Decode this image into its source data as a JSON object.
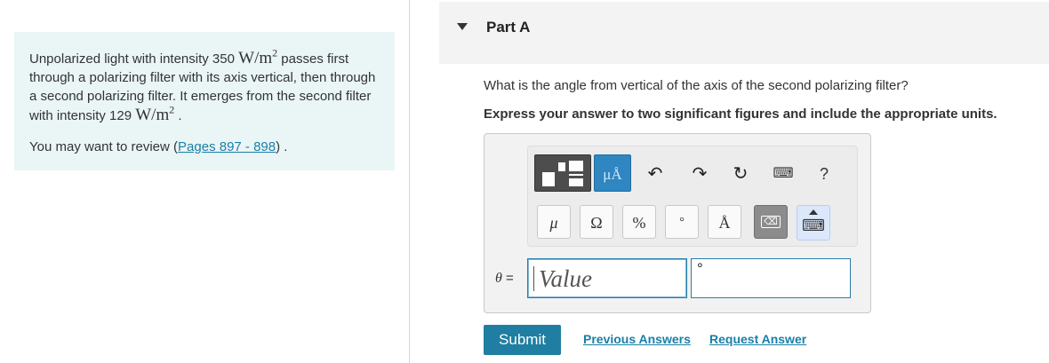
{
  "problem": {
    "text_part1": "Unpolarized light with intensity 350 ",
    "unit1_base": "W/m",
    "unit1_exp": "2",
    "text_part2": " passes first through a polarizing filter with its axis vertical, then through a second polarizing filter. It emerges from the second filter with intensity 129 ",
    "unit2_base": "W/m",
    "unit2_exp": "2",
    "text_part3": " .",
    "review_prefix": "You may want to review (",
    "review_link": "Pages 897 - 898",
    "review_suffix": ") ."
  },
  "part": {
    "title": "Part A",
    "question": "What is the angle from vertical of the axis of the second polarizing filter?",
    "instruction": "Express your answer to two significant figures and include the appropriate units."
  },
  "toolbar": {
    "units_button": "μÅ",
    "undo_glyph": "↶",
    "redo_glyph": "↷",
    "reset_glyph": "↻",
    "keyboard_glyph": "⌨",
    "help_glyph": "?",
    "symbols": [
      "μ",
      "Ω",
      "%",
      "°",
      "Å"
    ],
    "backspace_glyph": "⌫",
    "keyboard_toggle_glyph": "⌨",
    "icons": [
      "template-icon",
      "units-icon",
      "undo-icon",
      "redo-icon",
      "reset-icon",
      "keyboard-icon",
      "help-icon",
      "backspace-icon",
      "keyboard-toggle-icon"
    ]
  },
  "answer": {
    "variable": "θ",
    "equals": " =",
    "value_placeholder": "Value",
    "units_value": "°"
  },
  "actions": {
    "submit": "Submit",
    "previous_answers": "Previous Answers",
    "request_answer": "Request Answer"
  },
  "colors": {
    "panel_bg": "#eaf6f6",
    "accent": "#1f7ea1",
    "link": "#1a7fa8",
    "units_button_bg": "#2f86c0"
  }
}
